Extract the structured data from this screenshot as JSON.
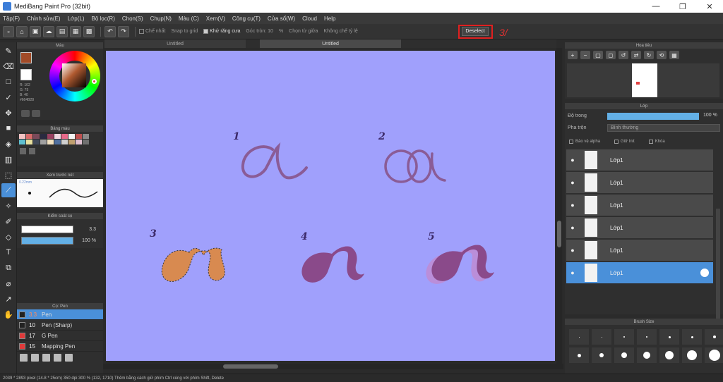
{
  "window": {
    "title": "MediBang Paint Pro (32bit)",
    "minimize": "—",
    "maximize": "❐",
    "close": "✕"
  },
  "menu": [
    "Tập(F)",
    "Chỉnh sửa(E)",
    "Lớp(L)",
    "Bộ lọc(R)",
    "Chọn(S)",
    "Chụp(N)",
    "Màu (C)",
    "Xem(V)",
    "Công cụ(T)",
    "Cửa sổ(W)",
    "Cloud",
    "Help"
  ],
  "toolbar": {
    "options": [
      {
        "label": "Chế nhất",
        "on": false
      },
      {
        "label": "Snap to grid",
        "on": false
      },
      {
        "label": "Khử răng cưa",
        "on": true
      },
      {
        "label": "Góc tròn: 10",
        "on": false
      },
      {
        "label": "%",
        "on": false
      },
      {
        "label": "Chọn từ giữa",
        "on": false
      },
      {
        "label": "Không chế tỷ lệ",
        "on": false
      }
    ],
    "deselect_label": "Deselect",
    "annotation": "3/"
  },
  "tabs": [
    "Untitled",
    "Untitled"
  ],
  "panels": {
    "color": {
      "title": "Màu",
      "values": [
        "R: 102",
        "G: 75",
        "B: 40",
        "#664B28"
      ]
    },
    "palette": {
      "title": "Bảng màu"
    },
    "brush_preview": {
      "title": "Xem trước nét",
      "size": "0.22mm"
    },
    "brush_control": {
      "title": "Kiểm soát cọ",
      "size_value": "3.3",
      "opacity_value": "100 %"
    },
    "pens": {
      "title": "Cọ: Pen",
      "items": [
        {
          "size": "3.3",
          "name": "Pen",
          "color": "#222222",
          "selected": true
        },
        {
          "size": "10",
          "name": "Pen (Sharp)",
          "color": "#222222",
          "selected": false
        },
        {
          "size": "17",
          "name": "G Pen",
          "color": "#e03a3a",
          "selected": false
        },
        {
          "size": "15",
          "name": "Mapping Pen",
          "color": "#e03a3a",
          "selected": false
        }
      ]
    },
    "navigator": {
      "title": "Hoa tiêu"
    },
    "layers": {
      "title": "Lớp",
      "opacity_label": "Độ trong",
      "opacity_value": "100 %",
      "blend_label": "Pha trộn",
      "blend_value": "Bình thường",
      "checks": [
        "Bảo vệ alpha",
        "Giữ Init",
        "Khóa"
      ],
      "items": [
        {
          "name": "Lớp1",
          "selected": false
        },
        {
          "name": "Lớp1",
          "selected": false
        },
        {
          "name": "Lớp1",
          "selected": false
        },
        {
          "name": "Lớp1",
          "selected": false
        },
        {
          "name": "Lớp1",
          "selected": false
        },
        {
          "name": "Lớp1",
          "selected": true
        }
      ]
    },
    "brush_size": {
      "title": "Brush Size"
    }
  },
  "canvas": {
    "background": "#a0a0fc",
    "labels": [
      "1",
      "2",
      "3",
      "4",
      "5"
    ]
  },
  "status": "2039 * 2893 pixel  (14.8 * 25cm)   350 dpi   300 %   (132, 1710)   Thêm bằng cách giữ phím Ctrl cùng với phím Shift, Delete"
}
